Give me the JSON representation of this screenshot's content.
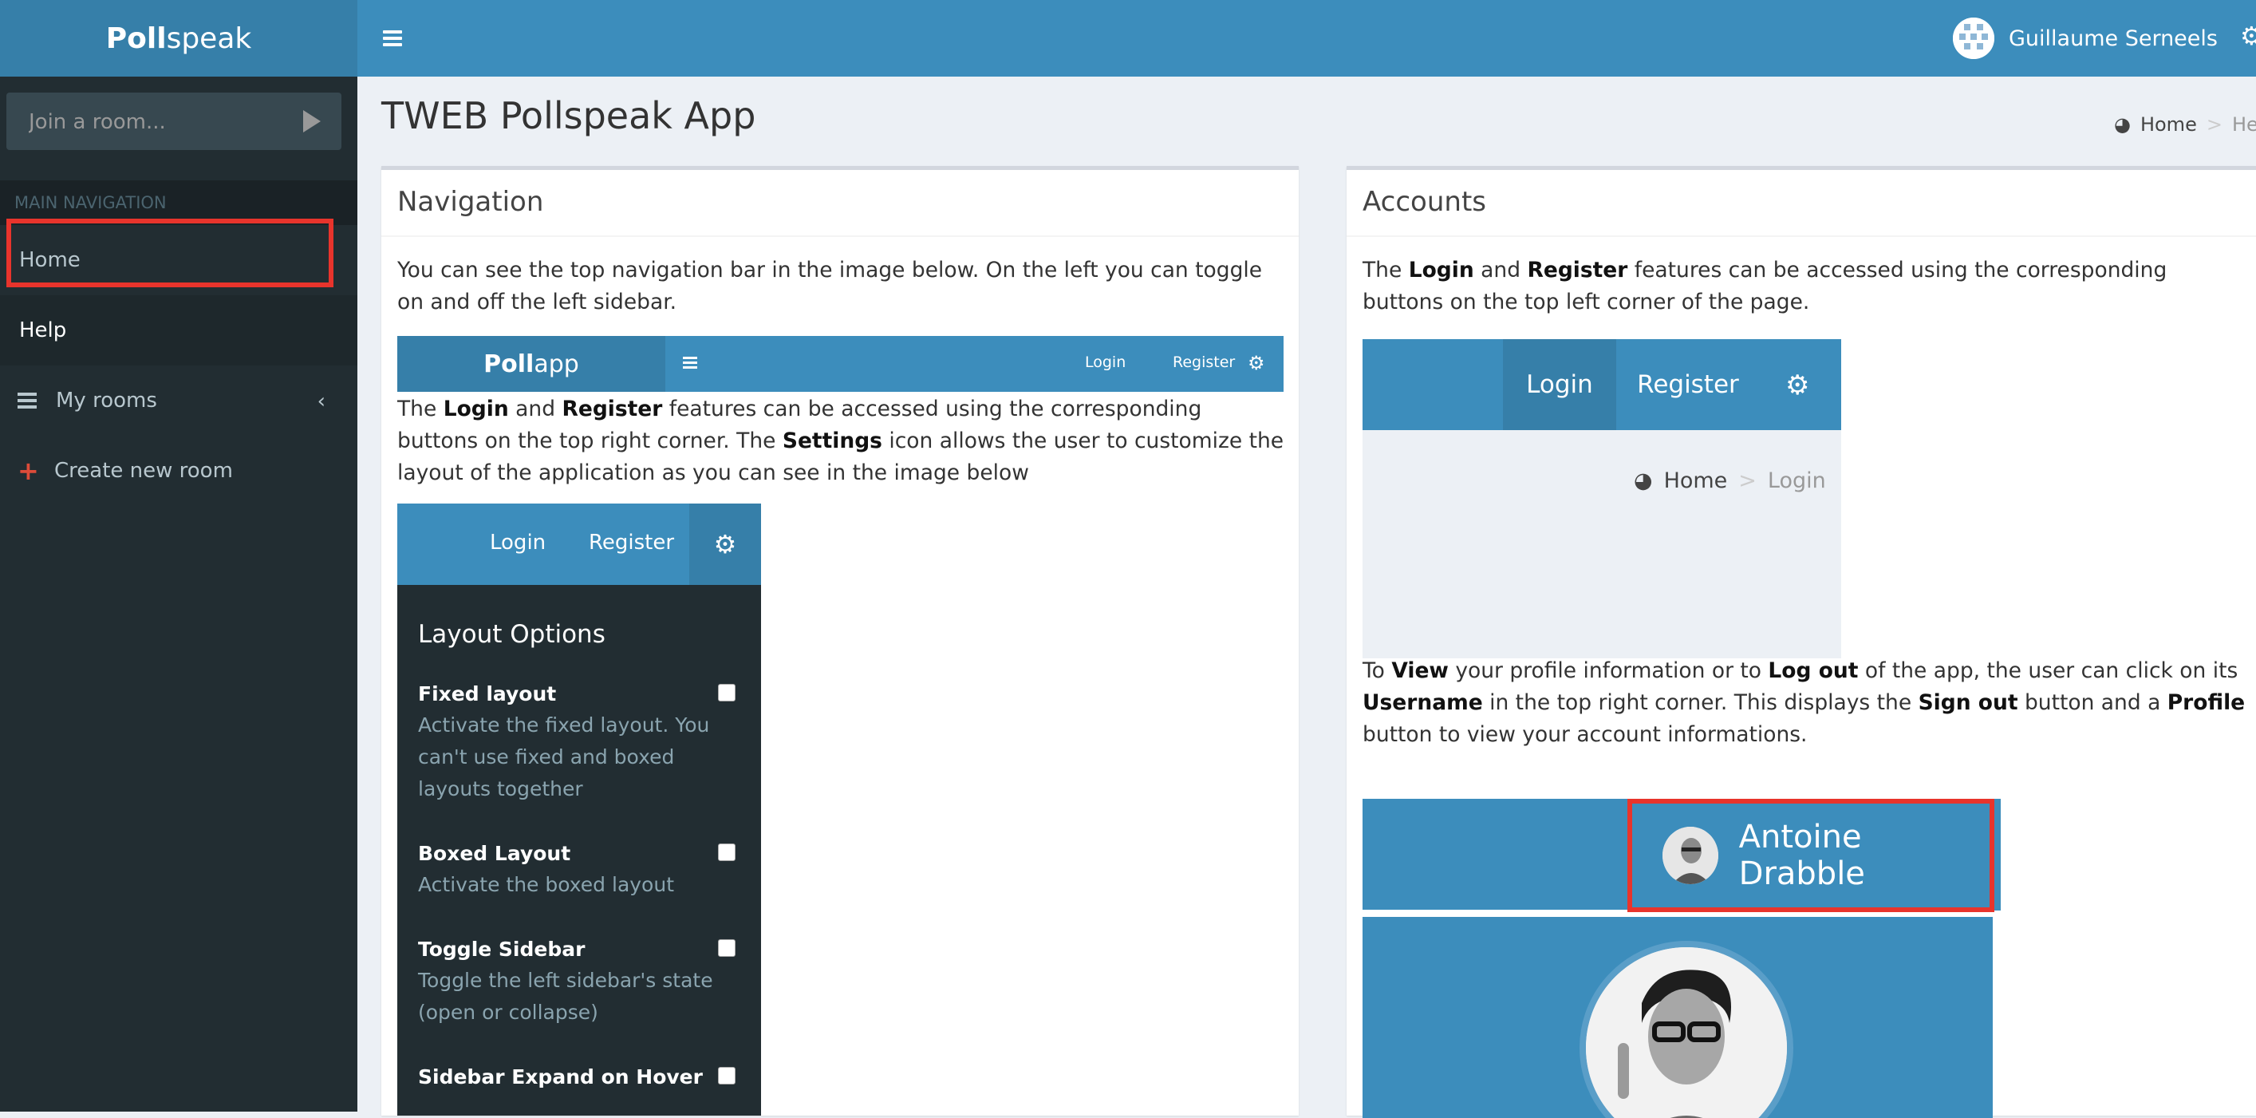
{
  "header": {
    "logo_bold": "Poll",
    "logo_light": "speak",
    "user_name": "Guillaume Serneels"
  },
  "sidebar": {
    "join_placeholder": "Join a room...",
    "section_header": "MAIN NAVIGATION",
    "items": [
      {
        "label": "Home"
      },
      {
        "label": "Help"
      },
      {
        "label": "My rooms"
      },
      {
        "label": "Create new room"
      }
    ]
  },
  "page": {
    "title": "TWEB Pollspeak App",
    "breadcrumb": [
      "Home",
      "Help"
    ]
  },
  "nav_box": {
    "title": "Navigation",
    "p1": "You can see the top navigation bar in the image below. On the left you can toggle on and off the left sidebar.",
    "p2": {
      "a": "The ",
      "b1": "Login",
      "c": " and ",
      "b2": "Register",
      "d": " features can be accessed using the corresponding buttons on the top right corner. The ",
      "b3": "Settings",
      "e": " icon allows the user to customize the layout of the application as you can see in the image below"
    },
    "mini_nav": {
      "logo_bold": "Poll",
      "logo_light": "app",
      "login": "Login",
      "register": "Register"
    },
    "layout": {
      "login": "Login",
      "register": "Register",
      "heading": "Layout Options",
      "options": [
        {
          "title": "Fixed layout",
          "desc": "Activate the fixed layout. You can't use fixed and boxed layouts together"
        },
        {
          "title": "Boxed Layout",
          "desc": "Activate the boxed layout"
        },
        {
          "title": "Toggle Sidebar",
          "desc": "Toggle the left sidebar's state (open or collapse)"
        },
        {
          "title": "Sidebar Expand on Hover",
          "desc": ""
        }
      ]
    }
  },
  "acc_box": {
    "title": "Accounts",
    "p1": {
      "a": "The ",
      "b1": "Login",
      "c": " and ",
      "b2": "Register",
      "d": " features can be accessed using the corresponding buttons on the top left corner of the page."
    },
    "shot1": {
      "login": "Login",
      "register": "Register",
      "crumb_home": "Home",
      "crumb_current": "Login"
    },
    "p2": {
      "a": "To ",
      "b1": "View",
      "c": " your profile information or to ",
      "b2": "Log out",
      "d": " of the app, the user can click on its ",
      "b3": "Username",
      "e": " in the top right corner. This displays the ",
      "b4": "Sign out",
      "f": " button and a ",
      "b5": "Profile",
      "g": " button to view your account informations."
    },
    "shot2": {
      "user_name": "Antoine Drabble"
    }
  },
  "colors": {
    "header": "#3c8dbc",
    "header_dark": "#367fa9",
    "sidebar": "#222d32",
    "highlight": "#e8342c",
    "content_bg": "#ecf0f5"
  }
}
